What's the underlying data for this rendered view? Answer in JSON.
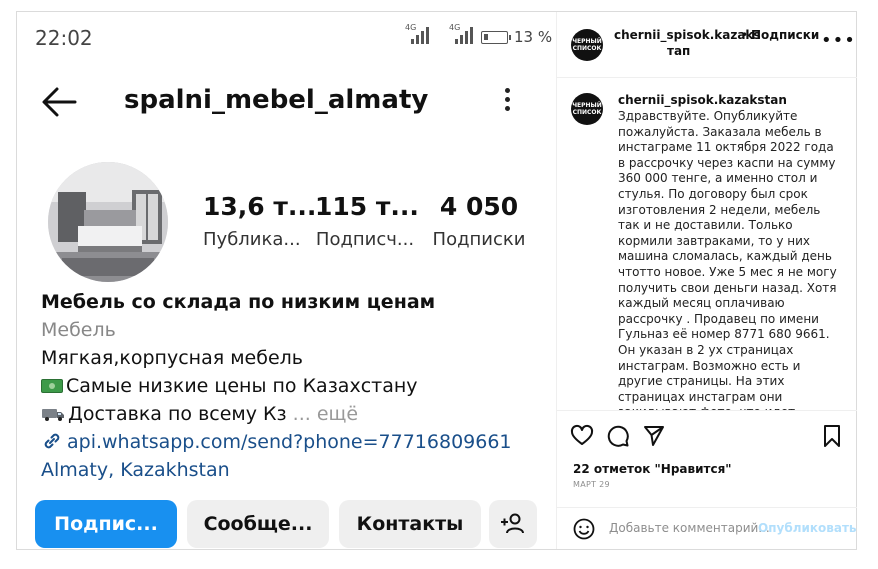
{
  "phone": {
    "status": {
      "time": "22:02",
      "signal1": "4G",
      "signal2": "4G",
      "battery": "13 %"
    },
    "profile": {
      "username": "spalni_mebel_almaty",
      "stats": [
        {
          "value": "13,6 т...",
          "label": "Публика..."
        },
        {
          "value": "115 т...",
          "label": "Подписч..."
        },
        {
          "value": "4 050",
          "label": "Подписки"
        }
      ],
      "bio": {
        "title": "Мебель со склада по низким ценам",
        "category": "Мебель",
        "line1": "Мягкая,корпусная мебель",
        "line2": "Самые низкие цены по Казахстану",
        "line3": "Доставка по всему Кз",
        "more": "... ещё",
        "link": "api.whatsapp.com/send?phone=77716809661",
        "location": "Almaty, Kazakhstan"
      },
      "buttons": {
        "follow": "Подпис...",
        "message": "Сообще...",
        "contacts": "Контакты"
      }
    }
  },
  "post": {
    "header": {
      "username": "chernii_spisok.kazaks",
      "dot": "•",
      "follow": "Подписки",
      "follow_wrap": "тап",
      "avatar_text": "ЧЕРНЫЙ СПИСОК"
    },
    "comment": {
      "username": "chernii_spisok.kazakstan",
      "text": "Здравствуйте. Опубликуйте пожалуйста. Заказала мебель в инстаграме 11 октября 2022 года в рассрочку через каспи на сумму 360 000 тенге, а именно стол и стулья. По договору был срок изготовления 2 недели, мебель так и не доставили. Только кормили завтраками, то у них машина сломалась, каждый день чтотто новое. Уже 5 мес я не могу получить свои деньги назад. Хотя каждый месяц оплачиваю рассрочку . Продавец по имени Гульназ её номер 8771 680 9661. Он указан в 2 ух страницах инстаграм. Возможно есть и другие страницы. На этих страницах инстаграм они закидывают фото, что идет"
    },
    "likes": "22 отметок \"Нравится\"",
    "date": "МАРТ 29",
    "comment_placeholder": "Добавьте комментарий...",
    "publish": "Опубликовать"
  }
}
